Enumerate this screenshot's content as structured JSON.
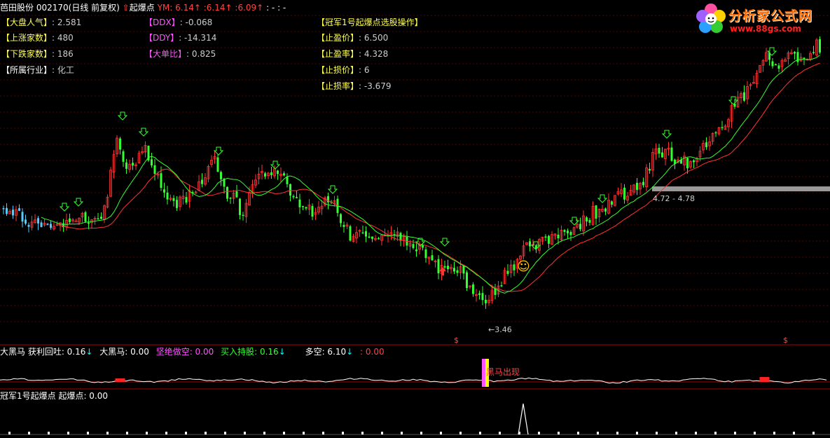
{
  "header": {
    "stock_name": "芭田股份",
    "stock_code": "002170",
    "period": "(日线 前复权)",
    "signal_name": "起爆点",
    "ym_label": "YM:",
    "ym_values": [
      "6.14",
      "6.14",
      "6.09"
    ],
    "ym_tail": ": - : -"
  },
  "info_left": [
    {
      "label": "【大盘人气】",
      "value": ": 2.581"
    },
    {
      "label": "【上涨家数】",
      "value": ": 480"
    },
    {
      "label": "【下跌家数】",
      "value": ": 186"
    },
    {
      "label": "【所属行业】",
      "value": ": 化工"
    }
  ],
  "info_mid": [
    {
      "label": "【DDX】",
      "value": ": -0.068"
    },
    {
      "label": "【DDY】",
      "value": ": -14.314"
    },
    {
      "label": "【大单比】",
      "value": ": 0.825"
    }
  ],
  "info_right": {
    "title": "【冠军1号起爆点选股操作】",
    "items": [
      {
        "label": "【止盈价】",
        "value": ":  6.500"
      },
      {
        "label": "【止盈率】",
        "value": ":  4.328"
      },
      {
        "label": "【止损价】",
        "value": ":  6"
      },
      {
        "label": "【止损率】",
        "value": ":  -3.679"
      }
    ]
  },
  "logo": {
    "title": "分析家公式网",
    "url": "www.88gs.com"
  },
  "annotations": {
    "low_price": "3.46",
    "range": "4.72 - 4.78",
    "smiley": "☺",
    "dollar": "$"
  },
  "panel2": {
    "items": [
      {
        "text": "大黑马  获利回吐: 0.16",
        "color": "#ffffff"
      },
      {
        "text": "↓",
        "color": "#00ffff"
      },
      {
        "text": "大黑马: 0.00",
        "color": "#ffffff"
      },
      {
        "text": "坚绝做空: 0.00",
        "color": "#ff55ff"
      },
      {
        "text": "买入持股: 0.16",
        "color": "#33ff33"
      },
      {
        "text": "↓",
        "color": "#00ffff"
      },
      {
        "text": "多空: 6.10",
        "color": "#ffffff"
      },
      {
        "text": "↓",
        "color": "#00ffff"
      },
      {
        "text": ": 0.00",
        "color": "#ff4444"
      }
    ],
    "marker_text": "黑马出现"
  },
  "panel3": {
    "title": "冠军1号起爆点  起爆点: 0.00"
  },
  "colors": {
    "up": "#ff3333",
    "down": "#33ff33",
    "early_down": "#55ccff",
    "ma1": "#ff3333",
    "ma2": "#33ff33",
    "grid": "#550000",
    "panel_border": "#aa0000"
  },
  "chart_data": {
    "type": "candlestick",
    "seed": 20170,
    "low": 3.46,
    "series": [
      {
        "name": "ma_red",
        "type": "line"
      },
      {
        "name": "ma_green",
        "type": "line"
      }
    ]
  }
}
